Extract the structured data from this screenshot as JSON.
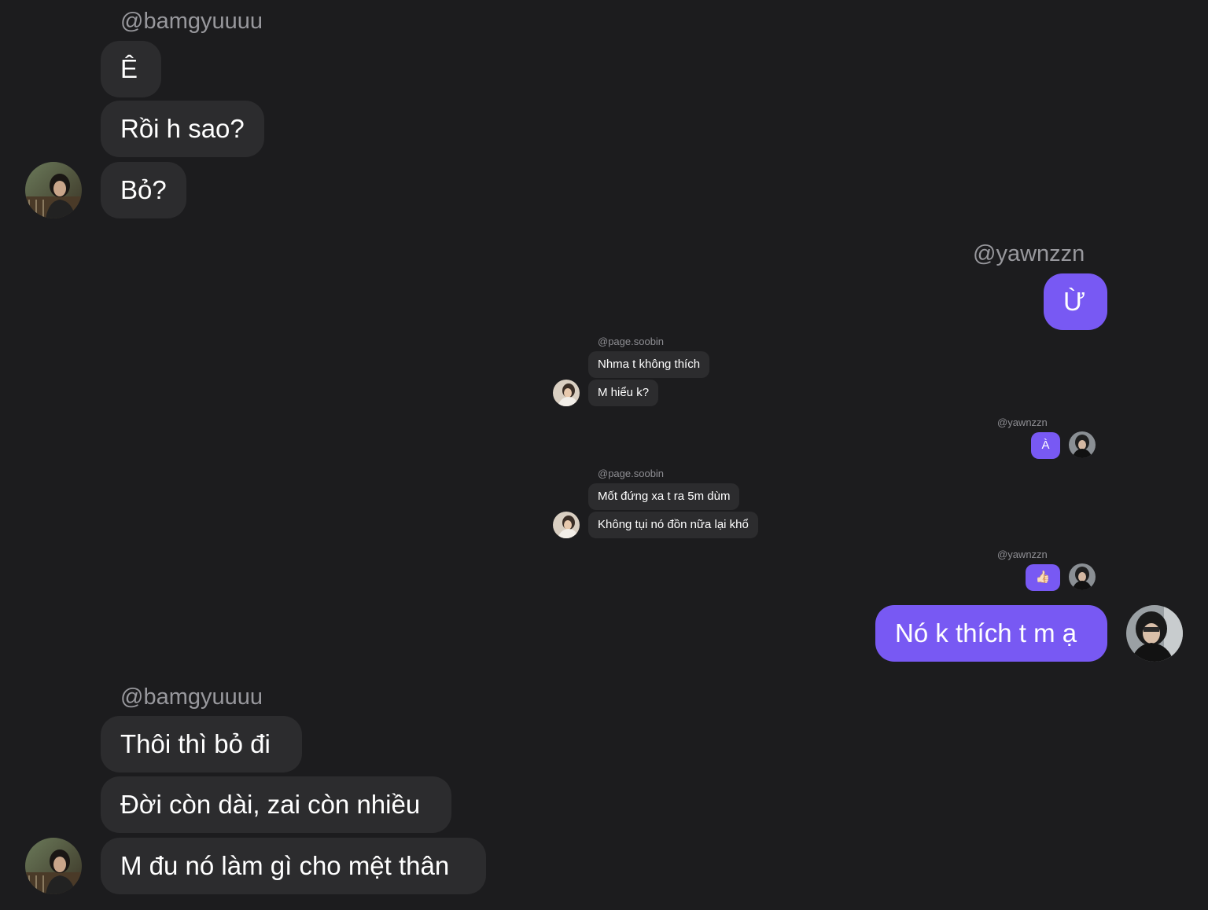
{
  "thread_top": {
    "username": "@bamgyuuuu",
    "messages": [
      "Ê",
      "Rồi h sao?",
      "Bỏ?"
    ]
  },
  "reply_top": {
    "username": "@yawnzzn",
    "message": "Ừ"
  },
  "quoted_screenshot": {
    "group1": {
      "username": "@page.soobin",
      "messages": [
        "Nhma t không thích",
        "M hiểu k?"
      ]
    },
    "reply1": {
      "username": "@yawnzzn",
      "message": "À"
    },
    "group2": {
      "username": "@page.soobin",
      "messages": [
        "Mốt đứng xa t ra 5m dùm",
        "Không tụi nó đồn nữa lại khổ"
      ]
    },
    "reply2": {
      "username": "@yawnzzn",
      "message": "👍🏻"
    }
  },
  "reply_bottom": {
    "message": "Nó k thích t m ạ"
  },
  "thread_bottom": {
    "username": "@bamgyuuuu",
    "messages": [
      "Thôi thì bỏ đi",
      "Đời còn dài, zai còn nhiều",
      "M đu nó làm gì cho mệt thân"
    ]
  },
  "colors": {
    "background": "#1c1c1e",
    "incoming_bubble": "#2c2c2e",
    "outgoing_bubble": "#7859f3",
    "username_text": "#98989d"
  },
  "icons": {
    "avatar_bamgyuuuu": "avatar-photo-bamgyuuuu",
    "avatar_yawnzzn": "avatar-photo-yawnzzn",
    "avatar_page_soobin": "avatar-photo-page-soobin"
  }
}
